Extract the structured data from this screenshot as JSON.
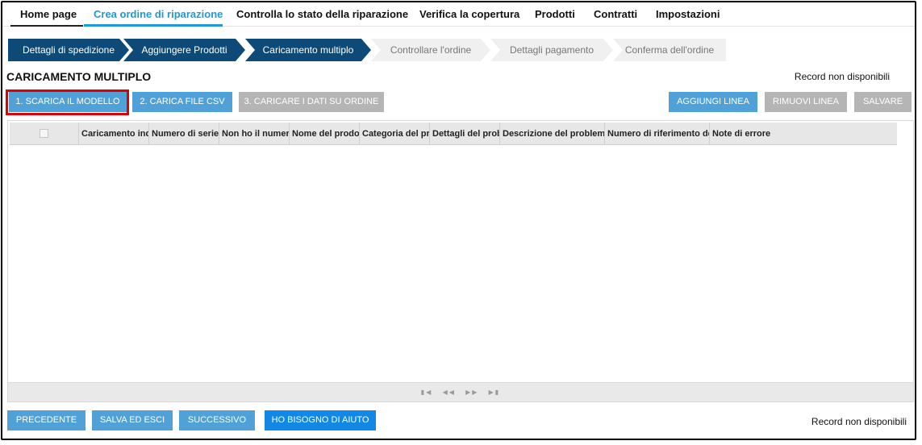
{
  "nav": {
    "items": [
      {
        "label": "Home page"
      },
      {
        "label": "Crea ordine di riparazione"
      },
      {
        "label": "Controlla lo stato della riparazione"
      },
      {
        "label": "Verifica la copertura"
      },
      {
        "label": "Prodotti"
      },
      {
        "label": "Contratti"
      },
      {
        "label": "Impostazioni"
      }
    ]
  },
  "steps": [
    {
      "label": "Dettagli di spedizione"
    },
    {
      "label": "Aggiungere Prodotti"
    },
    {
      "label": "Caricamento multiplo"
    },
    {
      "label": "Controllare l'ordine"
    },
    {
      "label": "Dettagli pagamento"
    },
    {
      "label": "Conferma dell'ordine"
    }
  ],
  "page": {
    "title": "CARICAMENTO MULTIPLO",
    "record_status_top": "Record non disponibili",
    "record_status_bottom": "Record non disponibili"
  },
  "toolbar": {
    "download_template": "1. SCARICA IL MODELLO",
    "upload_csv": "2. CARICA FILE CSV",
    "load_to_order": "3. CARICARE I DATI SU ORDINE",
    "add_line": "AGGIUNGI LINEA",
    "remove_line": "RIMUOVI LINEA",
    "save": "SALVARE"
  },
  "grid": {
    "columns": [
      "Caricamento indicizzato",
      "Numero di serie",
      "Non ho il numero di serie",
      "Nome del prodotto",
      "Categoria del problema",
      "Dettagli del problema",
      "Descrizione del problema",
      "Numero di riferimento del cliente",
      "Note di errore"
    ],
    "rows": []
  },
  "footer_buttons": {
    "previous": "PRECEDENTE",
    "save_exit": "SALVA ED ESCI",
    "next": "SUCCESSIVO",
    "help": "HO BISOGNO DI AIUTO"
  },
  "colors": {
    "accent": "#1f9ad6",
    "step_done": "#0d4a78",
    "step_todo": "#f0f0f0",
    "button_blue": "#4fa1d8",
    "button_gray": "#b5b5b5",
    "button_help": "#1188e6",
    "highlight": "#e00000"
  }
}
